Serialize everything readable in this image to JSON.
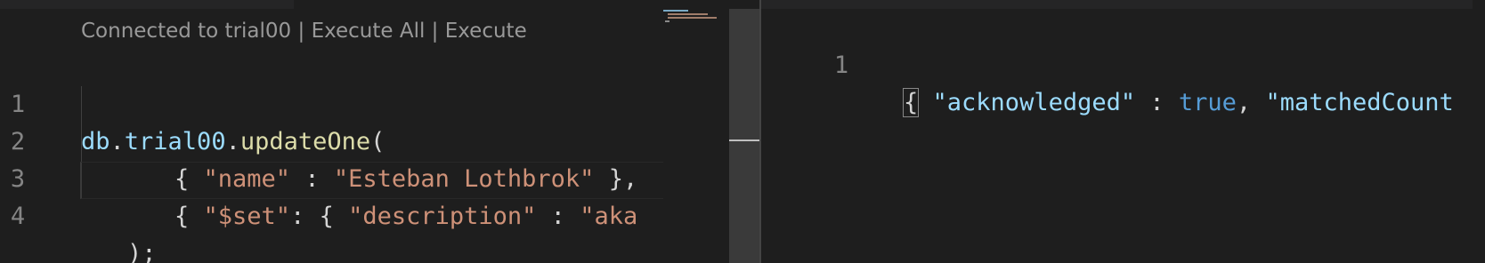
{
  "left_editor": {
    "codelens": {
      "connected": "Connected to trial00",
      "execute_all": "Execute All",
      "execute": "Execute",
      "separator": " | "
    },
    "lines": [
      {
        "number": "1",
        "tokens": [
          "db",
          ".",
          "trial00",
          ".",
          "updateOne",
          "("
        ]
      },
      {
        "number": "2",
        "tokens": [
          "{ ",
          "\"name\"",
          " : ",
          "\"Esteban Lothbrok\"",
          " },"
        ]
      },
      {
        "number": "3",
        "tokens": [
          "{ ",
          "\"$set\"",
          ": { ",
          "\"description\"",
          " : ",
          "\"aka"
        ]
      },
      {
        "number": "4",
        "tokens": [
          ");"
        ]
      }
    ]
  },
  "right_editor": {
    "lines": [
      {
        "number": "1",
        "tokens": [
          "{",
          " ",
          "\"acknowledged\"",
          " : ",
          "true",
          ", ",
          "\"matchedCount"
        ]
      }
    ]
  },
  "colors": {
    "background": "#1e1e1e",
    "variable": "#9cdcfe",
    "function": "#dcdcaa",
    "string": "#ce9178",
    "keyword": "#569cd6",
    "punctuation": "#d4d4d4",
    "line_number": "#858585",
    "codelens": "#999999"
  }
}
